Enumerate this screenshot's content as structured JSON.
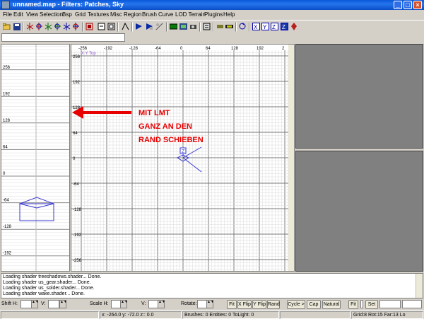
{
  "window": {
    "title": "unnamed.map - Filters: Patches, Sky"
  },
  "menu": [
    "File",
    "Edit",
    "View",
    "Selection",
    "Bsp",
    "Grid",
    "Textures",
    "Misc",
    "Region",
    "Brush",
    "Curve",
    "LOD Terrain",
    "Plugins",
    "Help"
  ],
  "toolbar": {
    "icons": [
      "open-icon",
      "save-icon",
      "flip-x-icon",
      "rotate-x-icon",
      "flip-y-icon",
      "rotate-y-icon",
      "flip-z-icon",
      "rotate-z-icon",
      "select-complete-tall-icon",
      "select-touching-icon",
      "select-partial-tall-icon",
      "select-inside-icon",
      "csg-subtract-icon",
      "csg-merge-icon",
      "clipper-icon",
      "change-views-icon",
      "texture-lock-icon",
      "camera-movement-icon",
      "hollow-icon",
      "vertex-edit-icon",
      "scale-icon",
      "x-axis-icon",
      "y-axis-icon",
      "z-axis-icon",
      "plugin-entity-icon"
    ]
  },
  "side_view": {
    "labels": [
      "256",
      "192",
      "128",
      "64",
      "0",
      "-64",
      "-128",
      "-192"
    ]
  },
  "main_view": {
    "x_labels": [
      "-256",
      "-192",
      "-128",
      "-64",
      "0",
      "64",
      "128",
      "192",
      "2"
    ],
    "y_labels": [
      "256",
      "192",
      "128",
      "64",
      "0",
      "-64",
      "-128",
      "-192",
      "-256"
    ],
    "view_label": "X Y  Top",
    "z_marker": "Z"
  },
  "annotation": {
    "lines": [
      "MIT LMT",
      "GANZ AN DEN",
      "RAND SCHIEBEN"
    ],
    "color": "#e60000"
  },
  "console": {
    "lines": [
      "Loading shader treeshadows.shader... Done.",
      "Loading shader us_gear.shader... Done.",
      "Loading shader us_solder.shader... Done.",
      "Loading shader wake.shader... Done."
    ]
  },
  "surface": {
    "shift_label": "Shift  H:",
    "v_label": "V:",
    "scale_label": "Scale  H:",
    "scale_v_label": "V:",
    "rotate_label": "Rotate:",
    "fit_label": "Fit",
    "xflip_label": "X Flip",
    "yflip_label": "Y Flip",
    "rand_label": "Rand",
    "cycle_label": "Cycle >",
    "cap_label": "Cap",
    "natural_label": "Natural",
    "fit2_label": "Fit",
    "set_label": "Set"
  },
  "status": {
    "coords": "x:  -264.0   y:  -72.0   z::  0.0",
    "counts": "Brushes: 0  Entities: 0  ToLight: 0",
    "grid": "Grid:8  Rot:15  Far:13  Lo"
  }
}
